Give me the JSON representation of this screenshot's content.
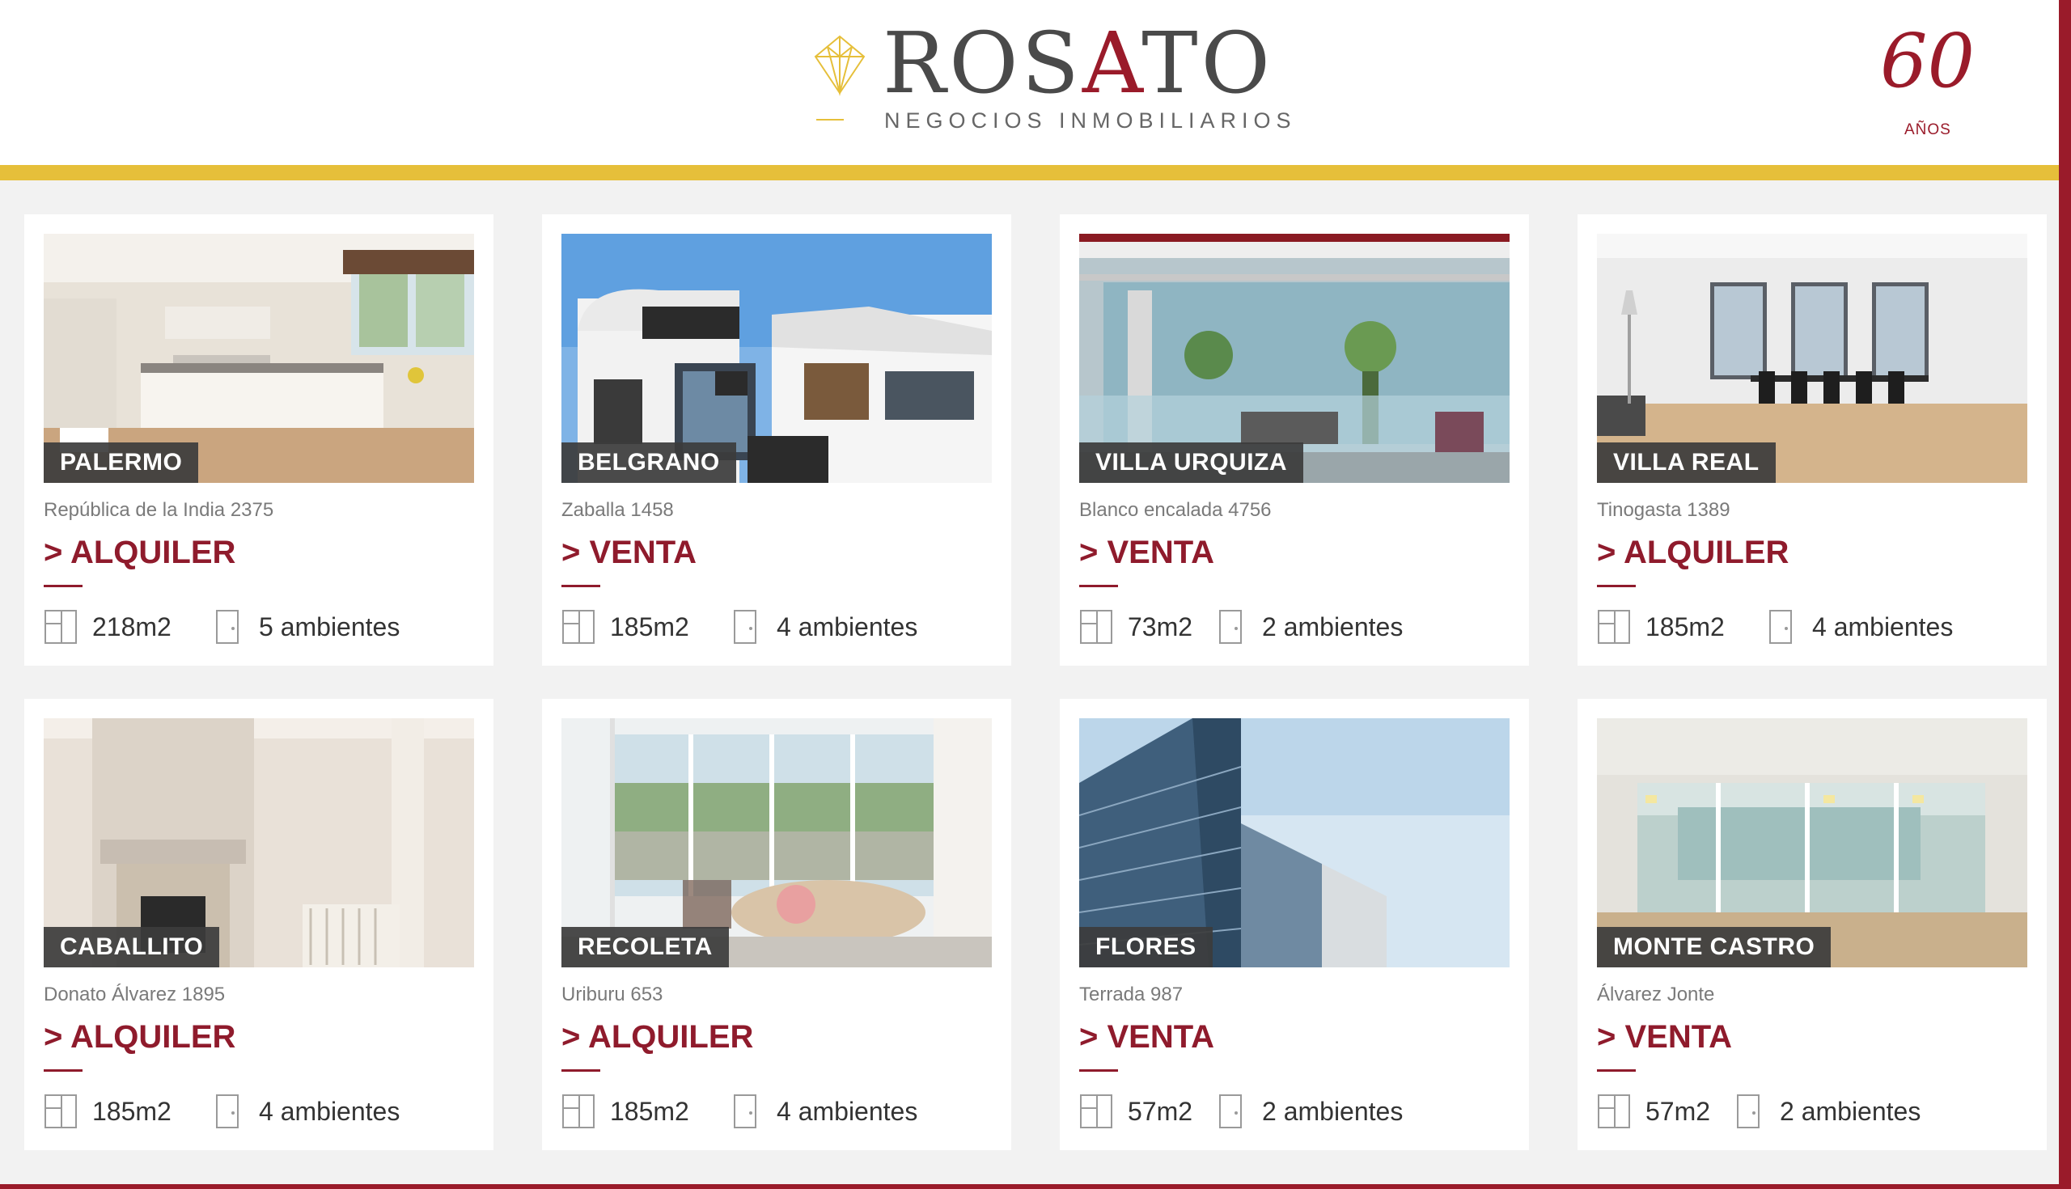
{
  "brand": {
    "name_pre": "ROS",
    "name_accent": "A",
    "name_post": "TO",
    "tagline": "NEGOCIOS INMOBILIARIOS",
    "anniversary_number": "60",
    "anniversary_label": "AÑOS",
    "colors": {
      "primary": "#8f1b2c",
      "gold": "#e6bf3a",
      "text": "#4a4a4a"
    }
  },
  "listings": [
    {
      "neighborhood": "PALERMO",
      "address": "República de la India 2375",
      "operation": "> ALQUILER",
      "area": "218m2",
      "rooms": "5 ambientes",
      "image": "kitchen-interior"
    },
    {
      "neighborhood": "BELGRANO",
      "address": "Zaballa 1458",
      "operation": "> VENTA",
      "area": "185m2",
      "rooms": "4 ambientes",
      "image": "modern-house"
    },
    {
      "neighborhood": "VILLA URQUIZA",
      "address": "Blanco encalada 4756",
      "operation": "> VENTA",
      "area": "73m2",
      "rooms": "2 ambientes",
      "image": "glass-balcony"
    },
    {
      "neighborhood": "VILLA REAL",
      "address": "Tinogasta 1389",
      "operation": "> ALQUILER",
      "area": "185m2",
      "rooms": "4 ambientes",
      "image": "dining-room"
    },
    {
      "neighborhood": "CABALLITO",
      "address": "Donato Álvarez 1895",
      "operation": "> ALQUILER",
      "area": "185m2",
      "rooms": "4 ambientes",
      "image": "fireplace-room"
    },
    {
      "neighborhood": "RECOLETA",
      "address": "Uriburu 653",
      "operation": "> ALQUILER",
      "area": "185m2",
      "rooms": "4 ambientes",
      "image": "living-room"
    },
    {
      "neighborhood": "FLORES",
      "address": "Terrada 987",
      "operation": "> VENTA",
      "area": "57m2",
      "rooms": "2 ambientes",
      "image": "tower-building"
    },
    {
      "neighborhood": "MONTE CASTRO",
      "address": "Álvarez Jonte",
      "operation": "> VENTA",
      "area": "57m2",
      "rooms": "2 ambientes",
      "image": "empty-office"
    }
  ]
}
